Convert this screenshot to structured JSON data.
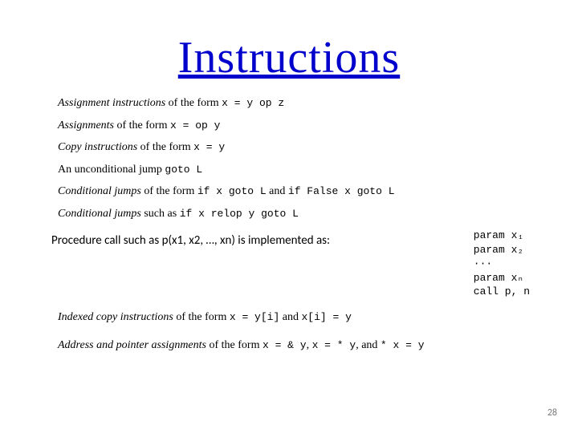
{
  "title": "Instructions",
  "items": {
    "i1_pre": "Assignment instructions",
    "i1_mid": " of the form ",
    "i1_code": "x = y op z",
    "i2_pre": "Assignments",
    "i2_mid": " of the form ",
    "i2_code": "x = op y",
    "i3_pre": "Copy instructions",
    "i3_mid": " of the form ",
    "i3_code": "x = y",
    "i4_pre": "An unconditional jump ",
    "i4_code": "goto L",
    "i5_pre": "Conditional jumps",
    "i5_mid": " of the form ",
    "i5_code1": "if x goto L",
    "i5_and": " and ",
    "i5_code2": "if False x goto L",
    "i6_pre": "Conditional jumps",
    "i6_mid": " such as ",
    "i6_code": "if x relop y goto L",
    "proc": "Procedure call such as p(x1, x2, …, xn) is implemented as:",
    "pb1": "param x₁",
    "pb2": "param x₂",
    "pb3": "···",
    "pb4": "param xₙ",
    "pb5": "call p, n",
    "i8_pre": "Indexed copy instructions",
    "i8_mid": " of the form ",
    "i8_code1": "x = y[i]",
    "i8_and": " and ",
    "i8_code2": "x[i] = y",
    "i9_pre": "Address and pointer assignments",
    "i9_mid": " of the form ",
    "i9_c1": "x = & y",
    "i9_sep1": ", ",
    "i9_c2": "x = * y",
    "i9_sep2": ", and ",
    "i9_c3": "* x = y"
  },
  "page_number": "28"
}
